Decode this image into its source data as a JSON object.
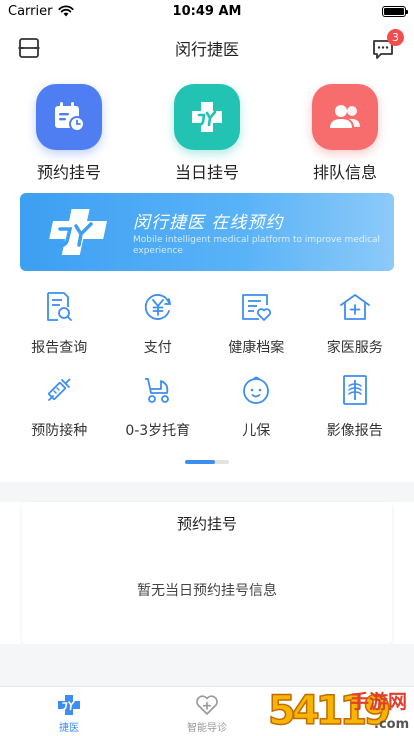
{
  "status_bar": {
    "carrier": "Carrier",
    "time": "10:49 AM",
    "battery_level": 1.0
  },
  "nav": {
    "title": "闵行捷医",
    "message_badge": "3"
  },
  "top_actions": [
    {
      "label": "预约挂号",
      "icon": "calendar-clock-icon",
      "color": "#4f7ef2"
    },
    {
      "label": "当日挂号",
      "icon": "jy-medical-cross-icon",
      "color": "#22c3b2"
    },
    {
      "label": "排队信息",
      "icon": "people-icon",
      "color": "#f76d6d"
    }
  ],
  "banner": {
    "title": "闵行捷医 在线预约",
    "subtitle": "Mobile intelligent medical platform to improve medical experience"
  },
  "services": [
    {
      "label": "报告查询",
      "icon": "report-search-icon"
    },
    {
      "label": "支付",
      "icon": "yen-payment-icon"
    },
    {
      "label": "健康档案",
      "icon": "health-record-icon"
    },
    {
      "label": "家医服务",
      "icon": "family-doctor-icon"
    },
    {
      "label": "预防接种",
      "icon": "syringe-icon"
    },
    {
      "label": "0-3岁托育",
      "icon": "stroller-icon"
    },
    {
      "label": "儿保",
      "icon": "baby-face-icon"
    },
    {
      "label": "影像报告",
      "icon": "xray-icon"
    }
  ],
  "pager": {
    "active_fraction": 0.68
  },
  "appointment_card": {
    "title": "预约挂号",
    "empty_text": "暂无当日预约挂号信息"
  },
  "tabs": [
    {
      "label": "捷医",
      "icon": "jy-tab-icon",
      "active": true
    },
    {
      "label": "智能导诊",
      "icon": "heart-plus-icon",
      "active": false
    }
  ],
  "watermark": {
    "text_number": "54119",
    "text_cn": "手游网",
    "text_url": ".com"
  },
  "colors": {
    "accent": "#3d8ef0",
    "icon_line": "#3d8ef0",
    "badge": "#f24e4e"
  }
}
